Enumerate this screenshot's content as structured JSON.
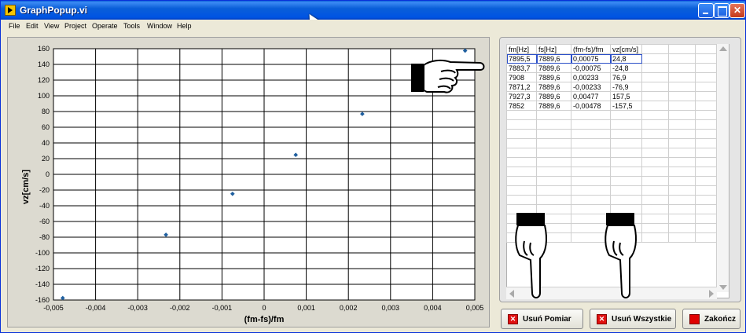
{
  "window": {
    "title": "GraphPopup.vi"
  },
  "menu": [
    "File",
    "Edit",
    "View",
    "Project",
    "Operate",
    "Tools",
    "Window",
    "Help"
  ],
  "chart_data": {
    "type": "scatter",
    "xlabel": "(fm-fs)/fm",
    "ylabel": "vz[cm/s]",
    "xlim": [
      -0.005,
      0.005
    ],
    "ylim": [
      -160,
      160
    ],
    "x_ticks": [
      "-0,005",
      "-0,004",
      "-0,003",
      "-0,002",
      "-0,001",
      "0",
      "0,001",
      "0,002",
      "0,003",
      "0,004",
      "0,005"
    ],
    "y_ticks": [
      "160",
      "140",
      "120",
      "100",
      "80",
      "60",
      "40",
      "20",
      "0",
      "-20",
      "-40",
      "-60",
      "-80",
      "-100",
      "-120",
      "-140",
      "-160"
    ],
    "grid": true,
    "points": [
      {
        "x": -0.00478,
        "y": -157.5
      },
      {
        "x": -0.00233,
        "y": -76.9
      },
      {
        "x": -0.00075,
        "y": -24.8
      },
      {
        "x": 0.00075,
        "y": 24.8
      },
      {
        "x": 0.00233,
        "y": 76.9
      },
      {
        "x": 0.00477,
        "y": 157.5
      }
    ],
    "point_color": "#1f5f9f"
  },
  "table": {
    "headers": [
      "fm[Hz]",
      "fs[Hz]",
      "(fm-fs)/fm",
      "vz[cm/s]"
    ],
    "rows": [
      [
        "7895,5",
        "7889,6",
        "0,00075",
        "24,8"
      ],
      [
        "7883,7",
        "7889,6",
        "-0,00075",
        "-24,8"
      ],
      [
        "7908",
        "7889,6",
        "0,00233",
        "76,9"
      ],
      [
        "7871,2",
        "7889,6",
        "-0,00233",
        "-76,9"
      ],
      [
        "7927,3",
        "7889,6",
        "0,00477",
        "157,5"
      ],
      [
        "7852",
        "7889,6",
        "-0,00478",
        "-157,5"
      ]
    ]
  },
  "buttons": {
    "usun_pomiar": "Usuń Pomiar",
    "usun_wszystkie": "Usuń Wszystkie",
    "zakoncz": "Zakończ"
  }
}
